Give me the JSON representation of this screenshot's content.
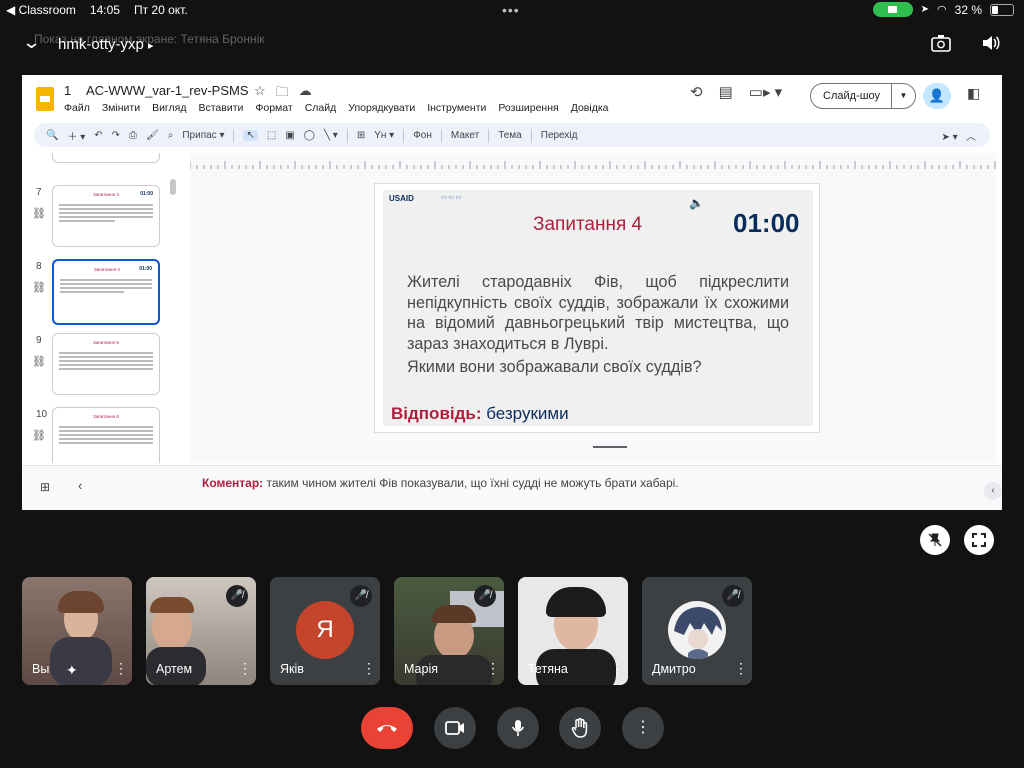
{
  "status": {
    "back_app": "◀ Classroom",
    "time": "14:05",
    "date": "Пт 20 окт.",
    "battery": "32 %",
    "battery_fraction": 0.32
  },
  "meet": {
    "presenting_note": "Показ на главном экране: Тетяна Броннік",
    "meeting_code": "hmk-otty-yxp",
    "code_arrow": "▸"
  },
  "docs": {
    "doc_num": "1",
    "doc_title": "AC-WWW_var-1_rev-PSMS",
    "menu": [
      "Файл",
      "Змінити",
      "Вигляд",
      "Вставити",
      "Формат",
      "Слайд",
      "Упорядкувати",
      "Інструменти",
      "Розширення",
      "Довідка"
    ],
    "slideshow_label": "Слайд-шоу",
    "toolbar": {
      "fit_label": "Припас",
      "bg_label": "Фон",
      "layout_label": "Макет",
      "theme_label": "Тема",
      "transition_label": "Перехід"
    }
  },
  "filmstrip": [
    {
      "num": "7",
      "title": "Запитання 3",
      "time": "01:00"
    },
    {
      "num": "8",
      "title": "Запитання 4",
      "time": "01:00",
      "selected": true
    },
    {
      "num": "9",
      "title": "Запитання 5",
      "time": "01:00"
    },
    {
      "num": "10",
      "title": "Запитання 6",
      "time": "01:00"
    }
  ],
  "slide": {
    "usaid": "USAID",
    "title": "Запитання 4",
    "timer": "01:00",
    "text": "Жителі стародавніх Фів, щоб підкреслити непідкупність своїх суддів, зображали їх схожими на відомий давньогрецький твір мистецтва, що зараз знаходиться в Луврі.",
    "question": "Якими вони зображавали своїх суддів?",
    "answer_label": "Відповідь:",
    "answer_value": "безрукими"
  },
  "notes": {
    "label": "Коментар:",
    "text": "таким чином жителі Фів показували, що їхні судді не можуть брати хабарі."
  },
  "participants": [
    {
      "name": "Вы"
    },
    {
      "name": "Артем"
    },
    {
      "name": "Яків",
      "initial": "Я"
    },
    {
      "name": "Марія"
    },
    {
      "name": "Тетяна"
    },
    {
      "name": "Дмитро"
    }
  ]
}
